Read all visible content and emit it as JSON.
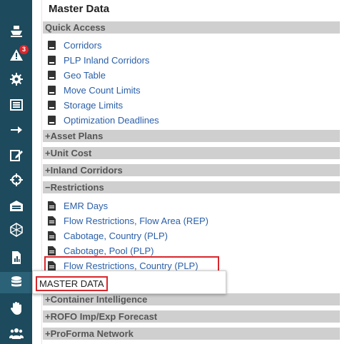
{
  "sidebar": {
    "alert_badge": "3",
    "icons": [
      {
        "name": "ship-icon"
      },
      {
        "name": "alert-icon"
      },
      {
        "name": "gear-icon"
      },
      {
        "name": "list-icon"
      },
      {
        "name": "arrow-right-icon"
      },
      {
        "name": "edit-icon"
      },
      {
        "name": "crosshair-icon"
      },
      {
        "name": "warehouse-icon"
      },
      {
        "name": "network-icon"
      },
      {
        "name": "report-icon"
      },
      {
        "name": "database-icon"
      },
      {
        "name": "hand-icon"
      },
      {
        "name": "users-icon"
      }
    ],
    "tooltip": "MASTER DATA"
  },
  "panel": {
    "title": "Master Data",
    "quick_access": {
      "header": "Quick Access",
      "items": [
        "Corridors",
        "PLP Inland Corridors",
        "Geo Table",
        "Move Count Limits",
        "Storage Limits",
        "Optimization Deadlines"
      ]
    },
    "asset_plans": {
      "sign": "+",
      "header": "Asset Plans"
    },
    "unit_cost": {
      "sign": "+",
      "header": "Unit Cost"
    },
    "inland_corridors": {
      "sign": "+",
      "header": "Inland Corridors"
    },
    "restrictions": {
      "sign": "−",
      "header": "Restrictions",
      "items": [
        "EMR Days",
        "Flow Restrictions, Flow Area (REP)",
        "Cabotage, Country (PLP)",
        "Cabotage, Pool (PLP)",
        "Flow Restrictions, Country (PLP)"
      ]
    },
    "container_intelligence": {
      "sign": "+",
      "header": "Container Intelligence"
    },
    "rofo": {
      "sign": "+",
      "header": "ROFO Imp/Exp Forecast"
    },
    "proforma": {
      "sign": "+",
      "header": "ProForma Network"
    }
  }
}
